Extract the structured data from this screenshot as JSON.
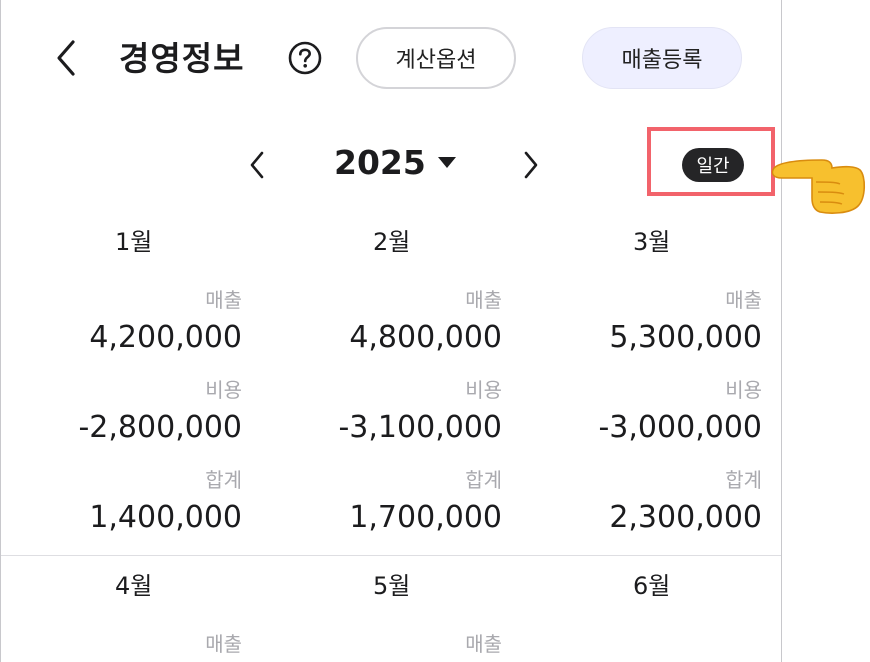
{
  "header": {
    "title": "경영정보",
    "calc_option_label": "계산옵션",
    "register_sales_label": "매출등록"
  },
  "year_selector": {
    "year": "2025",
    "mode_badge": "일간"
  },
  "months": [
    {
      "name": "1월",
      "sales_label": "매출",
      "sales": "4,200,000",
      "cost_label": "비용",
      "cost": "-2,800,000",
      "total_label": "합계",
      "total": "1,400,000"
    },
    {
      "name": "2월",
      "sales_label": "매출",
      "sales": "4,800,000",
      "cost_label": "비용",
      "cost": "-3,100,000",
      "total_label": "합계",
      "total": "1,700,000"
    },
    {
      "name": "3월",
      "sales_label": "매출",
      "sales": "5,300,000",
      "cost_label": "비용",
      "cost": "-3,000,000",
      "total_label": "합계",
      "total": "2,300,000"
    },
    {
      "name": "4월",
      "sales_label": "매출"
    },
    {
      "name": "5월",
      "sales_label": "매출"
    },
    {
      "name": "6월"
    }
  ],
  "colors": {
    "highlight": "#f2636b",
    "accent_bg": "#eeefff",
    "badge_bg": "#252527"
  }
}
